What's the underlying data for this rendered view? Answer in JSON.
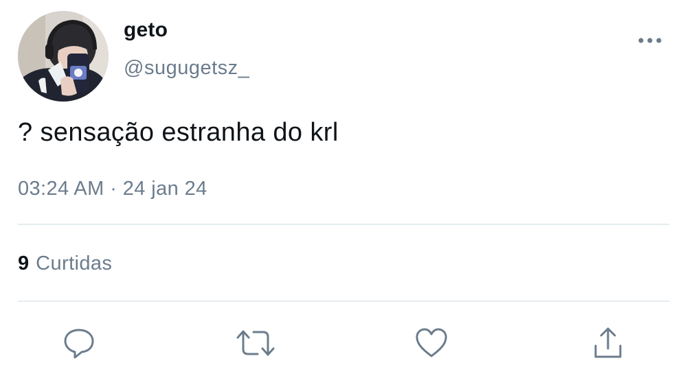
{
  "user": {
    "display_name": "geto",
    "handle": "@sugugetsz_"
  },
  "tweet": {
    "text": "? sensação estranha do krl",
    "time": "03:24 AM",
    "separator": "·",
    "date": "24 jan 24"
  },
  "stats": {
    "likes_count": "9",
    "likes_label": "Curtidas"
  },
  "colors": {
    "text_primary": "#0f1419",
    "text_secondary": "#6b7c8c",
    "divider": "#e6ecf0",
    "icon": "#6b7c8c"
  },
  "icons": {
    "more": "more-horizontal-icon",
    "reply": "reply-icon",
    "retweet": "retweet-icon",
    "like": "heart-icon",
    "share": "share-icon"
  }
}
